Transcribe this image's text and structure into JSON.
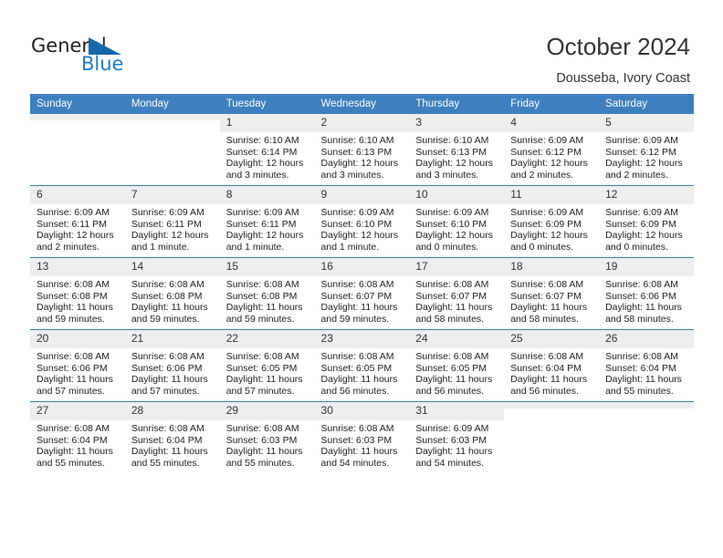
{
  "brand": {
    "name_part1": "General",
    "name_part2": "Blue",
    "logo_icon": "triangle-logo-icon",
    "color_dark": "#231f20",
    "color_blue": "#1f7cc2"
  },
  "header": {
    "title": "October 2024",
    "subtitle": "Dousseba, Ivory Coast"
  },
  "theme": {
    "header_bg": "#3e7fbf",
    "daynum_bg": "#eeeeee",
    "cell_bg": "#ffffff",
    "text": "#222222"
  },
  "weekdays": [
    "Sunday",
    "Monday",
    "Tuesday",
    "Wednesday",
    "Thursday",
    "Friday",
    "Saturday"
  ],
  "weeks": [
    [
      {
        "day": "",
        "sunrise": "",
        "sunset": "",
        "daylight1": "",
        "daylight2": ""
      },
      {
        "day": "",
        "sunrise": "",
        "sunset": "",
        "daylight1": "",
        "daylight2": ""
      },
      {
        "day": "1",
        "sunrise": "Sunrise: 6:10 AM",
        "sunset": "Sunset: 6:14 PM",
        "daylight1": "Daylight: 12 hours",
        "daylight2": "and 3 minutes."
      },
      {
        "day": "2",
        "sunrise": "Sunrise: 6:10 AM",
        "sunset": "Sunset: 6:13 PM",
        "daylight1": "Daylight: 12 hours",
        "daylight2": "and 3 minutes."
      },
      {
        "day": "3",
        "sunrise": "Sunrise: 6:10 AM",
        "sunset": "Sunset: 6:13 PM",
        "daylight1": "Daylight: 12 hours",
        "daylight2": "and 3 minutes."
      },
      {
        "day": "4",
        "sunrise": "Sunrise: 6:09 AM",
        "sunset": "Sunset: 6:12 PM",
        "daylight1": "Daylight: 12 hours",
        "daylight2": "and 2 minutes."
      },
      {
        "day": "5",
        "sunrise": "Sunrise: 6:09 AM",
        "sunset": "Sunset: 6:12 PM",
        "daylight1": "Daylight: 12 hours",
        "daylight2": "and 2 minutes."
      }
    ],
    [
      {
        "day": "6",
        "sunrise": "Sunrise: 6:09 AM",
        "sunset": "Sunset: 6:11 PM",
        "daylight1": "Daylight: 12 hours",
        "daylight2": "and 2 minutes."
      },
      {
        "day": "7",
        "sunrise": "Sunrise: 6:09 AM",
        "sunset": "Sunset: 6:11 PM",
        "daylight1": "Daylight: 12 hours",
        "daylight2": "and 1 minute."
      },
      {
        "day": "8",
        "sunrise": "Sunrise: 6:09 AM",
        "sunset": "Sunset: 6:11 PM",
        "daylight1": "Daylight: 12 hours",
        "daylight2": "and 1 minute."
      },
      {
        "day": "9",
        "sunrise": "Sunrise: 6:09 AM",
        "sunset": "Sunset: 6:10 PM",
        "daylight1": "Daylight: 12 hours",
        "daylight2": "and 1 minute."
      },
      {
        "day": "10",
        "sunrise": "Sunrise: 6:09 AM",
        "sunset": "Sunset: 6:10 PM",
        "daylight1": "Daylight: 12 hours",
        "daylight2": "and 0 minutes."
      },
      {
        "day": "11",
        "sunrise": "Sunrise: 6:09 AM",
        "sunset": "Sunset: 6:09 PM",
        "daylight1": "Daylight: 12 hours",
        "daylight2": "and 0 minutes."
      },
      {
        "day": "12",
        "sunrise": "Sunrise: 6:09 AM",
        "sunset": "Sunset: 6:09 PM",
        "daylight1": "Daylight: 12 hours",
        "daylight2": "and 0 minutes."
      }
    ],
    [
      {
        "day": "13",
        "sunrise": "Sunrise: 6:08 AM",
        "sunset": "Sunset: 6:08 PM",
        "daylight1": "Daylight: 11 hours",
        "daylight2": "and 59 minutes."
      },
      {
        "day": "14",
        "sunrise": "Sunrise: 6:08 AM",
        "sunset": "Sunset: 6:08 PM",
        "daylight1": "Daylight: 11 hours",
        "daylight2": "and 59 minutes."
      },
      {
        "day": "15",
        "sunrise": "Sunrise: 6:08 AM",
        "sunset": "Sunset: 6:08 PM",
        "daylight1": "Daylight: 11 hours",
        "daylight2": "and 59 minutes."
      },
      {
        "day": "16",
        "sunrise": "Sunrise: 6:08 AM",
        "sunset": "Sunset: 6:07 PM",
        "daylight1": "Daylight: 11 hours",
        "daylight2": "and 59 minutes."
      },
      {
        "day": "17",
        "sunrise": "Sunrise: 6:08 AM",
        "sunset": "Sunset: 6:07 PM",
        "daylight1": "Daylight: 11 hours",
        "daylight2": "and 58 minutes."
      },
      {
        "day": "18",
        "sunrise": "Sunrise: 6:08 AM",
        "sunset": "Sunset: 6:07 PM",
        "daylight1": "Daylight: 11 hours",
        "daylight2": "and 58 minutes."
      },
      {
        "day": "19",
        "sunrise": "Sunrise: 6:08 AM",
        "sunset": "Sunset: 6:06 PM",
        "daylight1": "Daylight: 11 hours",
        "daylight2": "and 58 minutes."
      }
    ],
    [
      {
        "day": "20",
        "sunrise": "Sunrise: 6:08 AM",
        "sunset": "Sunset: 6:06 PM",
        "daylight1": "Daylight: 11 hours",
        "daylight2": "and 57 minutes."
      },
      {
        "day": "21",
        "sunrise": "Sunrise: 6:08 AM",
        "sunset": "Sunset: 6:06 PM",
        "daylight1": "Daylight: 11 hours",
        "daylight2": "and 57 minutes."
      },
      {
        "day": "22",
        "sunrise": "Sunrise: 6:08 AM",
        "sunset": "Sunset: 6:05 PM",
        "daylight1": "Daylight: 11 hours",
        "daylight2": "and 57 minutes."
      },
      {
        "day": "23",
        "sunrise": "Sunrise: 6:08 AM",
        "sunset": "Sunset: 6:05 PM",
        "daylight1": "Daylight: 11 hours",
        "daylight2": "and 56 minutes."
      },
      {
        "day": "24",
        "sunrise": "Sunrise: 6:08 AM",
        "sunset": "Sunset: 6:05 PM",
        "daylight1": "Daylight: 11 hours",
        "daylight2": "and 56 minutes."
      },
      {
        "day": "25",
        "sunrise": "Sunrise: 6:08 AM",
        "sunset": "Sunset: 6:04 PM",
        "daylight1": "Daylight: 11 hours",
        "daylight2": "and 56 minutes."
      },
      {
        "day": "26",
        "sunrise": "Sunrise: 6:08 AM",
        "sunset": "Sunset: 6:04 PM",
        "daylight1": "Daylight: 11 hours",
        "daylight2": "and 55 minutes."
      }
    ],
    [
      {
        "day": "27",
        "sunrise": "Sunrise: 6:08 AM",
        "sunset": "Sunset: 6:04 PM",
        "daylight1": "Daylight: 11 hours",
        "daylight2": "and 55 minutes."
      },
      {
        "day": "28",
        "sunrise": "Sunrise: 6:08 AM",
        "sunset": "Sunset: 6:04 PM",
        "daylight1": "Daylight: 11 hours",
        "daylight2": "and 55 minutes."
      },
      {
        "day": "29",
        "sunrise": "Sunrise: 6:08 AM",
        "sunset": "Sunset: 6:03 PM",
        "daylight1": "Daylight: 11 hours",
        "daylight2": "and 55 minutes."
      },
      {
        "day": "30",
        "sunrise": "Sunrise: 6:08 AM",
        "sunset": "Sunset: 6:03 PM",
        "daylight1": "Daylight: 11 hours",
        "daylight2": "and 54 minutes."
      },
      {
        "day": "31",
        "sunrise": "Sunrise: 6:09 AM",
        "sunset": "Sunset: 6:03 PM",
        "daylight1": "Daylight: 11 hours",
        "daylight2": "and 54 minutes."
      },
      {
        "day": "",
        "sunrise": "",
        "sunset": "",
        "daylight1": "",
        "daylight2": ""
      },
      {
        "day": "",
        "sunrise": "",
        "sunset": "",
        "daylight1": "",
        "daylight2": ""
      }
    ]
  ]
}
